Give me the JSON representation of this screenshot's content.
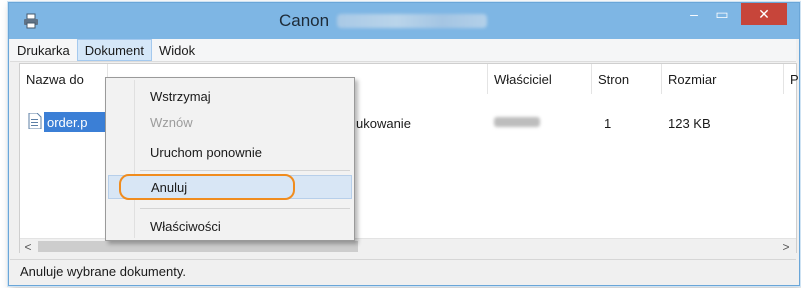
{
  "window": {
    "title": "Canon",
    "controls": {
      "minimize": "–",
      "maximize": "▭",
      "close": "✕"
    }
  },
  "menubar": {
    "items": [
      "Drukarka",
      "Dokument",
      "Widok"
    ],
    "active": "Dokument"
  },
  "columns": {
    "name": "Nazwa do",
    "owner": "Właściciel",
    "pages": "Stron",
    "size": "Rozmiar",
    "extra": "P"
  },
  "row": {
    "name": "order.p",
    "status": "ukowanie",
    "pages": "1",
    "size": "123 KB"
  },
  "dropdown": {
    "items": [
      {
        "label": "Wstrzymaj",
        "enabled": true
      },
      {
        "label": "Wznów",
        "enabled": false
      },
      {
        "label": "Uruchom ponownie",
        "enabled": true
      },
      {
        "label": "Anuluj",
        "enabled": true,
        "highlighted": true
      },
      {
        "label": "Właściwości",
        "enabled": true
      }
    ]
  },
  "scrollbar": {
    "left_arrow": "<",
    "right_arrow": ">"
  },
  "statusbar": {
    "text": "Anuluje wybrane dokumenty."
  },
  "colors": {
    "titlebar": "#7eb6e4",
    "close_button": "#c7453a",
    "selection": "#3b7fd6",
    "focus_ring": "#f08c1e"
  },
  "icons": {
    "title_icon": "printer-icon",
    "row_icon": "document-icon"
  }
}
